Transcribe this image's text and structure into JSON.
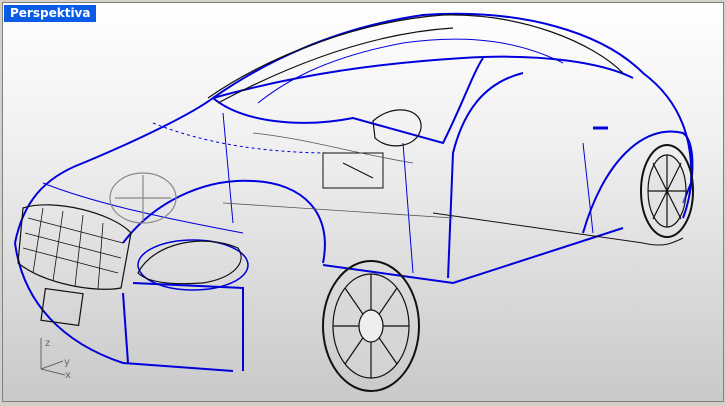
{
  "viewport": {
    "title": "Perspektiva",
    "title_bg": "#0a5ce6"
  },
  "axes": {
    "z": "z",
    "y": "y",
    "x": "x"
  },
  "colors": {
    "wire_blue": "#0000dd",
    "wire_black": "#111111"
  }
}
